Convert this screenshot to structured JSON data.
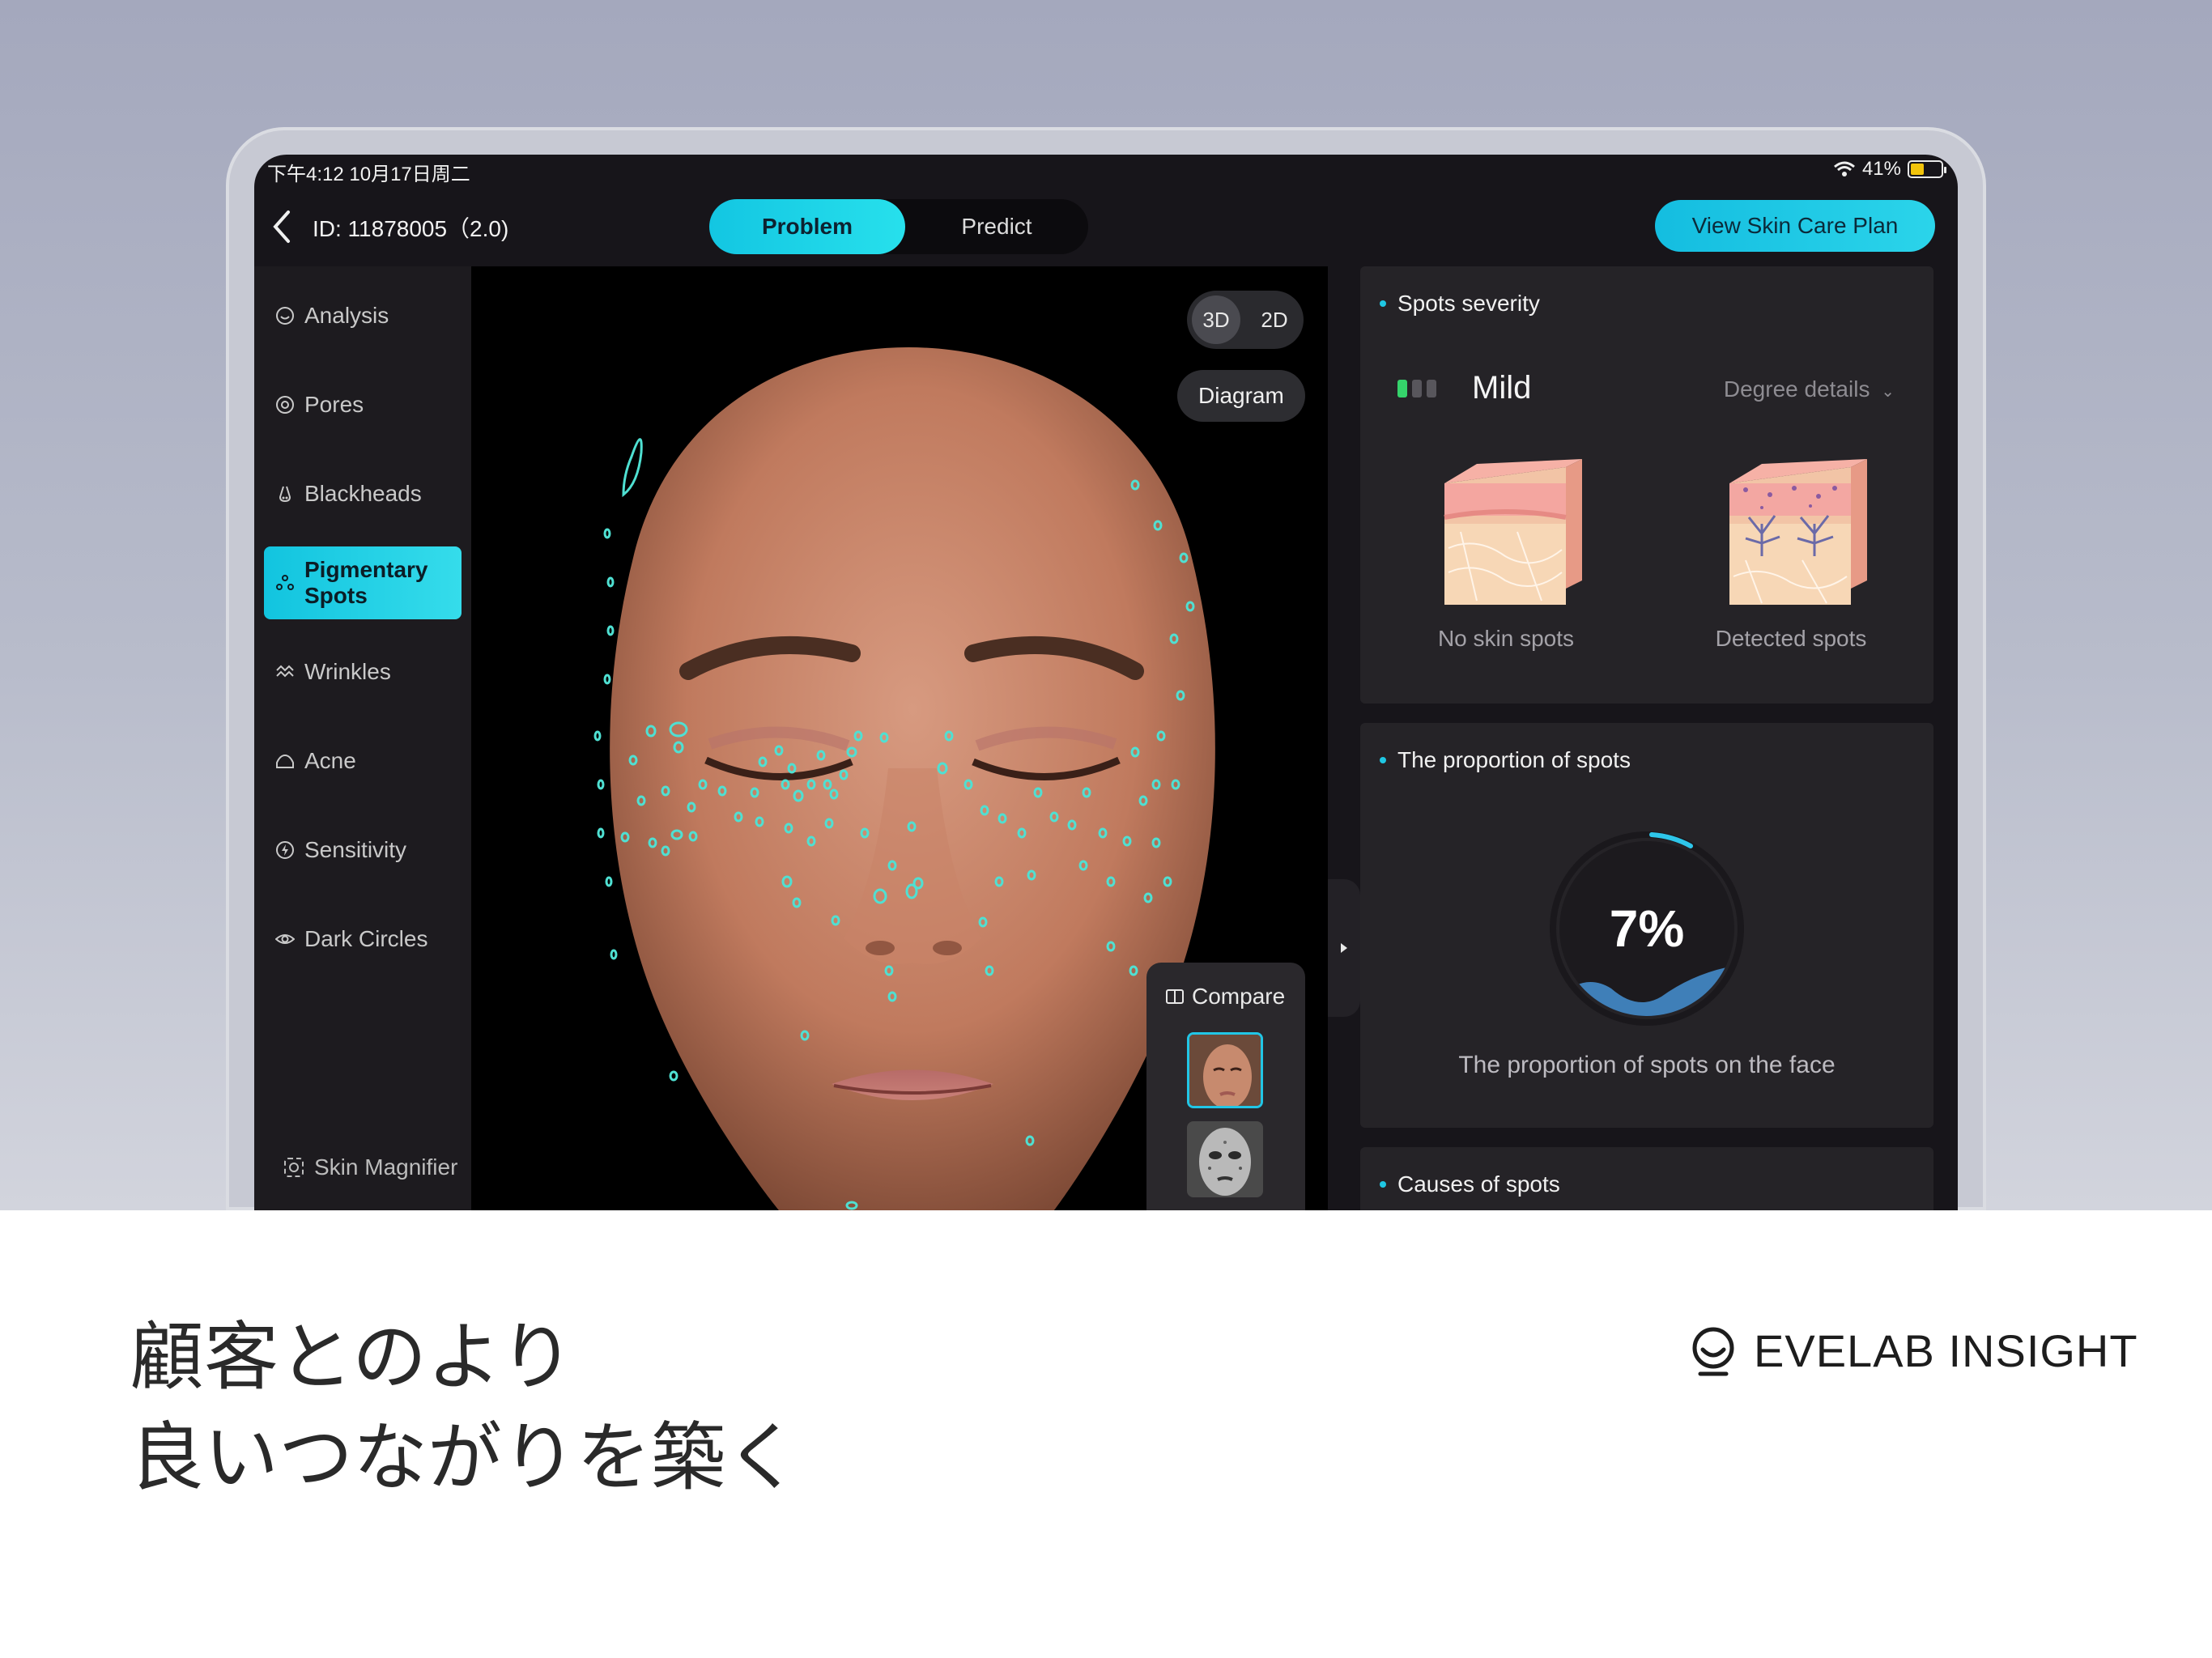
{
  "status_bar": {
    "time": "下午4:12   10月17日周二",
    "battery": "41%"
  },
  "header": {
    "record_id": "ID: 11878005（2.0)",
    "tabs": [
      {
        "label": "Problem",
        "active": true
      },
      {
        "label": "Predict",
        "active": false
      }
    ],
    "plan_button": "View Skin Care Plan"
  },
  "sidebar": {
    "items": [
      {
        "label": "Analysis",
        "icon": "smile-icon"
      },
      {
        "label": "Pores",
        "icon": "target-icon"
      },
      {
        "label": "Blackheads",
        "icon": "nose-icon"
      },
      {
        "label": "Pigmentary Spots",
        "icon": "dots-icon",
        "active": true
      },
      {
        "label": "Wrinkles",
        "icon": "wave-icon"
      },
      {
        "label": "Acne",
        "icon": "bump-icon"
      },
      {
        "label": "Sensitivity",
        "icon": "bolt-icon"
      },
      {
        "label": "Dark Circles",
        "icon": "eye-icon"
      }
    ],
    "magnifier": "Skin Magnifier"
  },
  "viewer": {
    "mode_3d": "3D",
    "mode_2d": "2D",
    "diagram_button": "Diagram",
    "compare_label": "Compare"
  },
  "severity": {
    "title": "Spots severity",
    "level": "Mild",
    "level_value": 1,
    "level_max": 3,
    "degree_details": "Degree details",
    "no_spots_caption": "No skin spots",
    "detected_caption": "Detected spots"
  },
  "proportion": {
    "title": "The proportion of spots",
    "value": "7%",
    "caption": "The proportion of spots on the face"
  },
  "causes": {
    "title": "Causes of spots"
  },
  "marketing": {
    "headline_line1": "顧客とのより",
    "headline_line2": "良いつながりを築く",
    "brand": "EVELAB INSIGHT"
  },
  "colors": {
    "accent": "#1fc7e3",
    "severity_on": "#35d36b",
    "spot_marker": "#4fe0d2",
    "panel_bg": "#252327"
  }
}
